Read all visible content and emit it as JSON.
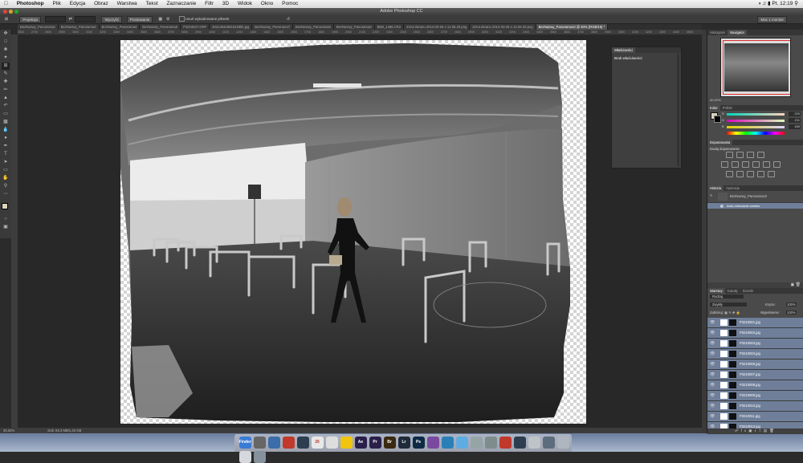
{
  "menubar": {
    "app": "Photoshop",
    "items": [
      "Plik",
      "Edycja",
      "Obraz",
      "Warstwa",
      "Tekst",
      "Zaznaczanie",
      "Filtr",
      "3D",
      "Widok",
      "Okno",
      "Pomoc"
    ],
    "clock": "Pt. 12:19"
  },
  "window_title": "Adobe Photoshop CC",
  "options": {
    "projection_label": "Projekcja",
    "clear_label": "Wyczyść",
    "straighten_label": "Prostowanie",
    "checkbox_label": "Usuń wykadrowane piksele",
    "workspace": "Mac 1 monitor"
  },
  "tabs": [
    {
      "label": "BezNazwy_Panorama2",
      "active": false
    },
    {
      "label": "BezNazwy_Panorama3",
      "active": false
    },
    {
      "label": "BezNazwy_Panorama4",
      "active": false
    },
    {
      "label": "BezNazwy_Panorama5",
      "active": false
    },
    {
      "label": "P1010547.ORF",
      "active": false
    },
    {
      "label": "3021494e6815328kb.jpg",
      "active": false
    },
    {
      "label": "BezNazwy_Panorama7",
      "active": false
    },
    {
      "label": "BezNazwy_Panorama8",
      "active": false
    },
    {
      "label": "BezNazwy_Panorama9",
      "active": false
    },
    {
      "label": "BEB_1486.CR2",
      "active": false
    },
    {
      "label": "Zrzut ekranu 2014-03-26 o 12.05.20.png",
      "active": false
    },
    {
      "label": "Zrzut ekranu 2014-03-26 o 12.06.33.png",
      "active": false
    },
    {
      "label": "BezNazwy_Panorama10 @ 40% (RGB/16) *",
      "active": true
    }
  ],
  "ruler_ticks": [
    "2600",
    "2700",
    "2800",
    "2900",
    "3000",
    "3100",
    "3200",
    "3300",
    "3400",
    "3500",
    "3600",
    "3700",
    "3800",
    "3900",
    "1000",
    "1100",
    "1200",
    "1300",
    "1400",
    "1500",
    "1600",
    "1700",
    "1800",
    "1900",
    "2000",
    "2100",
    "2200",
    "2300",
    "2400",
    "2500",
    "2600",
    "2700",
    "2800",
    "2900",
    "3000",
    "3100",
    "3200",
    "3300",
    "3400",
    "3500",
    "3600",
    "3700",
    "3800",
    "3900",
    "4000",
    "4100",
    "4200",
    "4300",
    "4400",
    "4500"
  ],
  "status": {
    "zoom": "40,02%",
    "doc": "Dok: 83,3 MB/1,43 GB"
  },
  "properties": {
    "tab": "Właściwości",
    "body": "Brak właściwości"
  },
  "navigator": {
    "tabs": [
      "Histogram",
      "Navigator"
    ],
    "zoom": "40,02%"
  },
  "color": {
    "tabs": [
      "Kolor",
      "Próbki"
    ],
    "sliders": [
      {
        "label": "R",
        "value": "220"
      },
      {
        "label": "G",
        "value": "211"
      },
      {
        "label": "B",
        "value": "189"
      }
    ]
  },
  "adjustments": {
    "tab": "Dopasowania",
    "title": "Dodaj dopasowanie"
  },
  "history": {
    "tabs": [
      "Historia",
      "Operacje"
    ],
    "items": [
      "BezNazwy_Panorama10",
      "Auto-mieszanie warstw"
    ]
  },
  "layers": {
    "tabs": [
      "Warstwy",
      "Kanały",
      "Ścieżki"
    ],
    "kind": "Rodzaj",
    "blend": "Zwykły",
    "opacity_label": "Krycie:",
    "opacity": "100%",
    "lock_label": "Zablokuj:",
    "fill_label": "Wypełnienie:",
    "fill": "100%",
    "items": [
      "P3210001.jpg",
      "P3210002.jpg",
      "P3210003.jpg",
      "P3210004.jpg",
      "P3210006.jpg",
      "P3210007.jpg",
      "P3210008.jpg",
      "P3210009.jpg",
      "P3210010.jpg",
      "P3210011.jpg",
      "P3210012.jpg"
    ]
  },
  "dock": [
    {
      "label": "Finder",
      "color": "#3a7bd5"
    },
    {
      "label": "",
      "color": "#666"
    },
    {
      "label": "",
      "color": "#3b6ea8"
    },
    {
      "label": "",
      "color": "#c0392b"
    },
    {
      "label": "",
      "color": "#2c3e50"
    },
    {
      "label": "26",
      "color": "#e8e8e8"
    },
    {
      "label": "",
      "color": "#ddd"
    },
    {
      "label": "",
      "color": "#f1c40f"
    },
    {
      "label": "Ae",
      "color": "#2a1f4a"
    },
    {
      "label": "Pr",
      "color": "#2a1f4a"
    },
    {
      "label": "Br",
      "color": "#3b2a10"
    },
    {
      "label": "Lr",
      "color": "#1f2a3a"
    },
    {
      "label": "Ps",
      "color": "#0f2a45"
    },
    {
      "label": "",
      "color": "#7a4aa0"
    },
    {
      "label": "",
      "color": "#2980b9"
    },
    {
      "label": "",
      "color": "#5dade2"
    },
    {
      "label": "",
      "color": "#95a5a6"
    },
    {
      "label": "",
      "color": "#7f8c8d"
    },
    {
      "label": "",
      "color": "#c0392b"
    },
    {
      "label": "",
      "color": "#2c3e50"
    },
    {
      "label": "",
      "color": "#bdc3c7"
    },
    {
      "label": "",
      "color": "#5d6d7e"
    },
    {
      "label": "",
      "color": "#aeb6bf"
    },
    {
      "label": "",
      "color": "#d5d8dc"
    },
    {
      "label": "",
      "color": "#85929e"
    }
  ]
}
